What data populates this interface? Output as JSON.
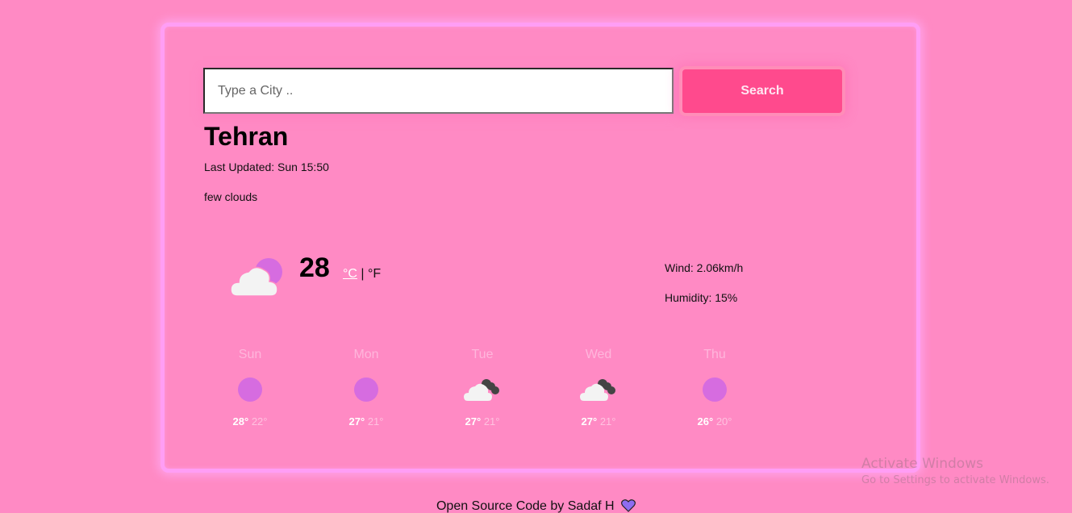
{
  "search": {
    "placeholder": "Type a City ..",
    "value": "",
    "button_label": "Search"
  },
  "current": {
    "city": "Tehran",
    "last_updated": "Last Updated: Sun 15:50",
    "description": "few clouds",
    "icon": "few-clouds-icon",
    "temperature": "28",
    "unit_celsius": "°C",
    "unit_separator": " | ",
    "unit_fahrenheit": "°F",
    "wind": "Wind: 2.06km/h",
    "humidity": "Humidity: 15%"
  },
  "forecast": [
    {
      "day": "Sun",
      "icon": "sun-icon",
      "high": "28°",
      "low": "22°"
    },
    {
      "day": "Mon",
      "icon": "sun-icon",
      "high": "27°",
      "low": "21°"
    },
    {
      "day": "Tue",
      "icon": "broken-clouds-icon",
      "high": "27°",
      "low": "21°"
    },
    {
      "day": "Wed",
      "icon": "broken-clouds-icon",
      "high": "27°",
      "low": "21°"
    },
    {
      "day": "Thu",
      "icon": "sun-icon",
      "high": "26°",
      "low": "20°"
    }
  ],
  "colors": {
    "background": "#ff8ac4",
    "card_border": "#ff9ef5",
    "button": "#ff4a8d",
    "sun": "#d66ce0",
    "cloud": "#f3f3f3",
    "dark_cloud": "#444444"
  },
  "footer": {
    "text": "Open Source Code",
    "by": " by Sadaf H",
    "heart_icon": "purple-heart-icon"
  },
  "watermark": {
    "title": "Activate Windows",
    "subtitle": "Go to Settings to activate Windows."
  }
}
